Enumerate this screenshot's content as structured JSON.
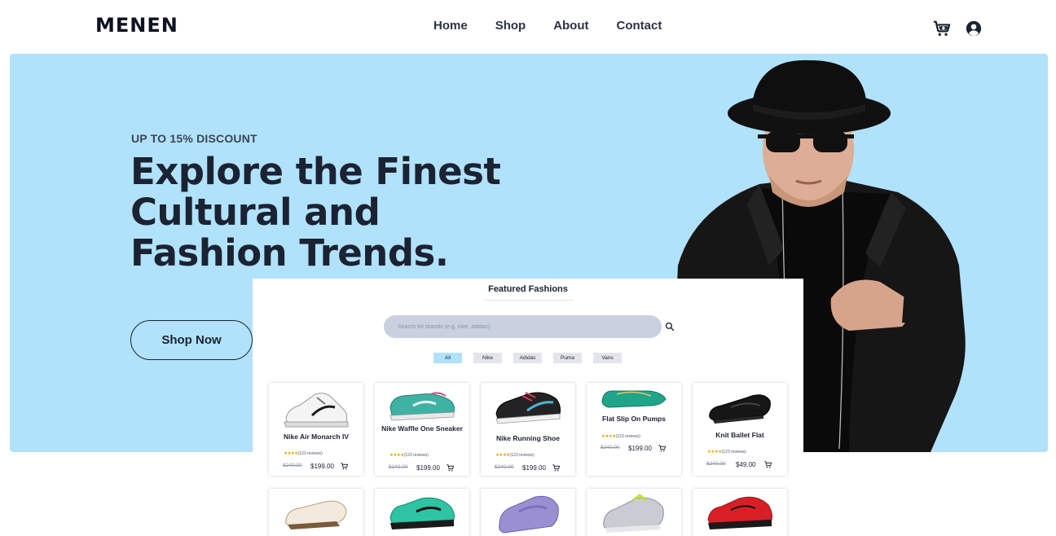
{
  "header": {
    "logo": "MENEN",
    "nav": [
      "Home",
      "Shop",
      "About",
      "Contact"
    ],
    "icons": [
      "cart-plus-icon",
      "user-circle-icon"
    ]
  },
  "hero": {
    "eyebrow": "UP TO 15% DISCOUNT",
    "headline_lines": [
      "Explore the Finest",
      "Cultural and",
      "Fashion Trends."
    ],
    "cta": "Shop Now",
    "background_color": "#b1e2fb"
  },
  "featured": {
    "title": "Featured Fashions",
    "search_placeholder": "Search for brands (e.g. nike, adidas)",
    "filters": [
      "All",
      "Nike",
      "Adidas",
      "Puma",
      "Vans"
    ],
    "active_filter": "All",
    "products": [
      {
        "name": "Nike Air Monarch IV",
        "stars": "★★★★",
        "reviews": "(123 reviews)",
        "old_price": "$240.00",
        "price": "$199.00"
      },
      {
        "name": "Nike Waffle One Sneaker",
        "stars": "★★★★",
        "reviews": "(123 reviews)",
        "old_price": "$240.00",
        "price": "$199.00"
      },
      {
        "name": "Nike Running Shoe",
        "stars": "★★★★",
        "reviews": "(123 reviews)",
        "old_price": "$240.00",
        "price": "$199.00"
      },
      {
        "name": "Flat Slip On Pumps",
        "stars": "★★★★",
        "reviews": "(123 reviews)",
        "old_price": "$240.00",
        "price": "$199.00"
      },
      {
        "name": "Knit Ballet Flat",
        "stars": "★★★★",
        "reviews": "(123 reviews)",
        "old_price": "$240.00",
        "price": "$49.00"
      }
    ]
  },
  "colors": {
    "text_dark": "#1b2232",
    "chip_active": "#b1e2fb",
    "search_bg": "#c9d1e0"
  }
}
